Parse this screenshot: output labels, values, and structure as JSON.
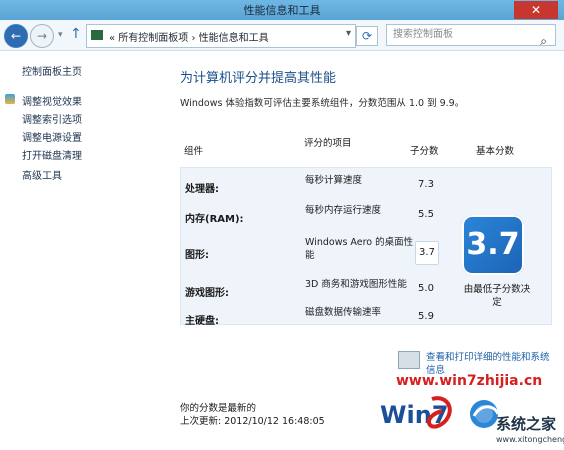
{
  "window": {
    "title": "性能信息和工具",
    "close_icon": "✕"
  },
  "navigation": {
    "back_icon": "←",
    "forward_icon": "→",
    "dropdown_icon": "▾",
    "up_icon": "↑",
    "address_text": "« 所有控制面板项  ›  性能信息和工具",
    "address_dropdown_icon": "▾",
    "refresh_icon": "⟳",
    "search_placeholder": "搜索控制面板",
    "search_icon": "⌕"
  },
  "sidebar": {
    "items": [
      {
        "label": "控制面板主页"
      },
      {
        "label": "调整视觉效果"
      },
      {
        "label": "调整索引选项"
      },
      {
        "label": "调整电源设置"
      },
      {
        "label": "打开磁盘清理"
      },
      {
        "label": "高级工具"
      }
    ]
  },
  "main": {
    "title": "为计算机评分并提高其性能",
    "description": "Windows 体验指数可评估主要系统组件，分数范围从 1.0 到 9.9。",
    "table": {
      "headers": {
        "component": "组件",
        "rating": "评分的项目",
        "subscore": "子分数",
        "basescore": "基本分数"
      },
      "rows": [
        {
          "component": "处理器:",
          "desc": "每秒计算速度",
          "score": "7.3"
        },
        {
          "component": "内存(RAM):",
          "desc": "每秒内存运行速度",
          "score": "5.5"
        },
        {
          "component": "图形:",
          "desc": "Windows Aero 的桌面性能",
          "score": "3.7"
        },
        {
          "component": "游戏图形:",
          "desc": "3D 商务和游戏图形性能",
          "score": "5.0"
        },
        {
          "component": "主硬盘:",
          "desc": "磁盘数据传输速率",
          "score": "5.9"
        }
      ],
      "base_score": "3.7",
      "base_note": "由最低子分数决定"
    },
    "links": {
      "print_details": "查看和打印详细的性能和系统信息"
    },
    "status": {
      "latest": "你的分数是最新的",
      "updated": "上次更新: 2012/10/12 16:48:05"
    }
  },
  "watermarks": {
    "win7_url": "www.win7zhijia.cn",
    "win7_logo_text": "Win7",
    "system_home_text": "系统之家",
    "system_home_url": "www.xitongcheng.com"
  },
  "colors": {
    "title_blue": "#1a4f88",
    "link_blue": "#1a5fa8",
    "badge_blue": "#1c63b6",
    "close_red": "#c7372f",
    "watermark_red": "#d62020"
  }
}
